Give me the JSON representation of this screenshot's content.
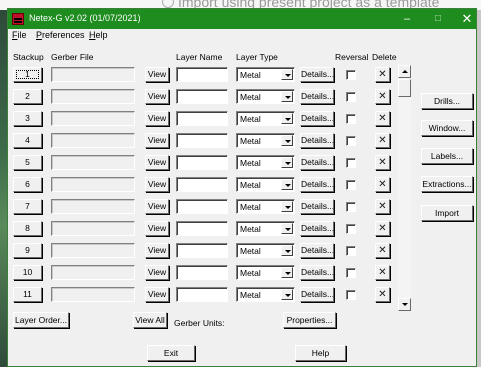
{
  "background": {
    "ghost_text": "Import using present project as a template"
  },
  "window": {
    "title": "Netex-G v2.02 (01/07/2021)",
    "controls": {
      "minimize": "–",
      "maximize": "□",
      "close": "✕"
    }
  },
  "menu": [
    {
      "label": "File",
      "accel": "F",
      "rest": "ile"
    },
    {
      "label": "Preferences",
      "accel": "P",
      "rest": "references"
    },
    {
      "label": "Help",
      "accel": "H",
      "rest": "elp"
    }
  ],
  "headers": {
    "stackup": "Stackup",
    "gerber_file": "Gerber File",
    "layer_name": "Layer Name",
    "layer_type": "Layer Type",
    "reversal": "Reversal",
    "delete": "Delete"
  },
  "row_buttons": {
    "view": "View",
    "details": "Details...",
    "delete": "✕"
  },
  "rows": [
    {
      "num": "1",
      "gerber_file": "",
      "layer_name": "",
      "layer_type": "Metal",
      "reversal": false
    },
    {
      "num": "2",
      "gerber_file": "",
      "layer_name": "",
      "layer_type": "Metal",
      "reversal": false
    },
    {
      "num": "3",
      "gerber_file": "",
      "layer_name": "",
      "layer_type": "Metal",
      "reversal": false
    },
    {
      "num": "4",
      "gerber_file": "",
      "layer_name": "",
      "layer_type": "Metal",
      "reversal": false
    },
    {
      "num": "5",
      "gerber_file": "",
      "layer_name": "",
      "layer_type": "Metal",
      "reversal": false
    },
    {
      "num": "6",
      "gerber_file": "",
      "layer_name": "",
      "layer_type": "Metal",
      "reversal": false
    },
    {
      "num": "7",
      "gerber_file": "",
      "layer_name": "",
      "layer_type": "Metal",
      "reversal": false
    },
    {
      "num": "8",
      "gerber_file": "",
      "layer_name": "",
      "layer_type": "Metal",
      "reversal": false
    },
    {
      "num": "9",
      "gerber_file": "",
      "layer_name": "",
      "layer_type": "Metal",
      "reversal": false
    },
    {
      "num": "10",
      "gerber_file": "",
      "layer_name": "",
      "layer_type": "Metal",
      "reversal": false
    },
    {
      "num": "11",
      "gerber_file": "",
      "layer_name": "",
      "layer_type": "Metal",
      "reversal": false
    }
  ],
  "side_buttons": [
    "Drills...",
    "Window...",
    "Labels...",
    "Extractions...",
    "Import"
  ],
  "bottom": {
    "layer_order": "Layer Order...",
    "view_all": "View All",
    "gerber_units_label": "Gerber Units:",
    "properties": "Properties...",
    "exit": "Exit",
    "help": "Help"
  },
  "colors": {
    "titlebar": "#1e8c1e",
    "window_bg": "#f0f0f0",
    "icon_red": "#c0102a"
  }
}
